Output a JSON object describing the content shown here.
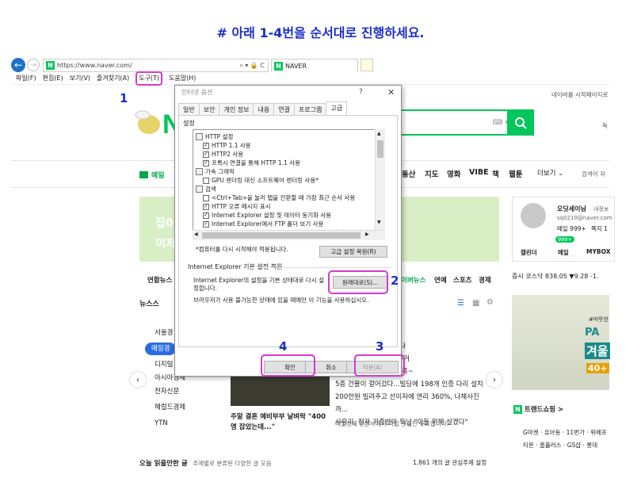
{
  "instruction": "# 아래 1-4번을 순서대로 진행하세요.",
  "browser": {
    "url": "https://www.naver.com/",
    "address_icons": "⌕ ▾ 🔒 C",
    "tab_label": "NAVER",
    "menu": [
      "파일(F)",
      "편집(E)",
      "보기(V)",
      "즐겨찾기(A)",
      "도구(T)",
      "도움말(H)"
    ]
  },
  "callouts": {
    "one": "1",
    "two": "2",
    "three": "3",
    "four": "4"
  },
  "naver": {
    "logo_letter": "N",
    "top_link": "네이버를 시작페이지로",
    "top_link_short": "독",
    "mail": "메일",
    "services": [
      "동산",
      "지도",
      "영화",
      "VIBE",
      "책",
      "웹툰"
    ],
    "more": "더보기 ⌄",
    "weather_hint": "검색어 저",
    "banner_line1": "집0",
    "banner_line2": "이저",
    "login_name": "오딧세이님",
    "login_sub": "내정보",
    "login_email": "sq0210@naver.com",
    "login_mail": "메일 999+",
    "login_cafe": "쪽지 1",
    "login_tabs": [
      "캘린더",
      "메일",
      "MYBOX"
    ],
    "mail_badge": "999+",
    "news_tabs": [
      "연합뉴스",
      "이버뉴스",
      "연예",
      "스포츠",
      "경제"
    ],
    "stock": "증시  코스닥 838.05  ▼9.28 -1.",
    "newsstand": "뉴스스",
    "papers": [
      "서울경",
      "매일경",
      "디지털",
      "아시아경제",
      "전자신문",
      "헤럴드경제",
      "YTN"
    ],
    "news_lines": [
      "임즈 직원들, 얼마나 받나",
      "중에도 코로나 가차라 우거",
      "주...아이들은 후폭탐에 푹~",
      "5층 건물이 걸어갔다...빌딩에 198개 인증 다리 설치",
      "200만원 빌려주고 선이자에 연리 360%, 나체사진까...",
      "사유리, 정자 기증받아 득남 \"아들 위해 살겠다\""
    ],
    "photo_caption": "주말 결혼 예비부부 날벼락 \"400명 잡았는데...\"",
    "news_source": "매일경제 언론사에서 직접 편집한 뉴스입니다.",
    "ad_text1": "#따뜻한",
    "ad_text2": "PA",
    "ad_text3": "겨울",
    "ad_text4": "40+",
    "trend": "트렌드쇼핑 >",
    "trend_row1": "G마켓 · 유아동 · 11번가 · 위메프",
    "trend_row2": "티몬 · 홈플러스 · GS샵 · 롯데",
    "bottom_left": "오늘 읽을만한 글",
    "bottom_sub": "주제별로 분류된 다양한 글 모음",
    "bottom_right": "1,861 개의 글   관심주제 설정"
  },
  "dialog": {
    "title": "인터넷 옵션",
    "help": "?",
    "close": "✕",
    "tabs": [
      "일반",
      "보안",
      "개인 정보",
      "내용",
      "연결",
      "프로그램",
      "고급"
    ],
    "settings_label": "설정",
    "settings": [
      {
        "type": "folder",
        "label": "HTTP 설정"
      },
      {
        "type": "check",
        "checked": true,
        "label": "HTTP 1.1 사용"
      },
      {
        "type": "check",
        "checked": true,
        "label": "HTTP2 사용"
      },
      {
        "type": "check",
        "checked": true,
        "label": "프록시 연결을 통해 HTTP 1.1 사용"
      },
      {
        "type": "folder",
        "label": "가속 그래픽"
      },
      {
        "type": "check",
        "checked": false,
        "label": "GPU 렌더링 대신 소프트웨어 렌더링 사용*"
      },
      {
        "type": "folder",
        "label": "검색"
      },
      {
        "type": "check",
        "checked": false,
        "label": "<Ctrl+Tab>을 눌러 탭을 전환할 때 가장 최근 순서 사용"
      },
      {
        "type": "check",
        "checked": true,
        "label": "HTTP 오류 메시지 표시"
      },
      {
        "type": "check",
        "checked": true,
        "label": "Internet Explorer 설정 및 데이터 동기화 사용"
      },
      {
        "type": "check",
        "checked": true,
        "label": "Internet Explorer에서 FTP 폴더 보기 사용"
      },
      {
        "type": "check",
        "checked": true,
        "label": "Internet Explorer 주소 표시줄 및 열기 대화 상자에서 인라인 자"
      }
    ],
    "restart_note": "*컴퓨터를 다시 시작해야 적용됩니다.",
    "adv_restore": "고급 설정 복원(R)",
    "reset_group": "Internet Explorer 기본 설정 복원",
    "reset_text": "Internet Explorer의 설정을 기본 상태대로 다시 설정합니다.",
    "reset_button": "원래대로(S)...",
    "reset_note": "브라우저가 사용 불가능한 상태에 있을 때에만 이 기능을 사용하십시오.",
    "ok": "확인",
    "cancel": "취소",
    "apply": "적용(A)"
  },
  "colors": {
    "accent": "#d63ad0",
    "naver_green": "#03c75a",
    "callout_blue": "#1a2ec8"
  }
}
